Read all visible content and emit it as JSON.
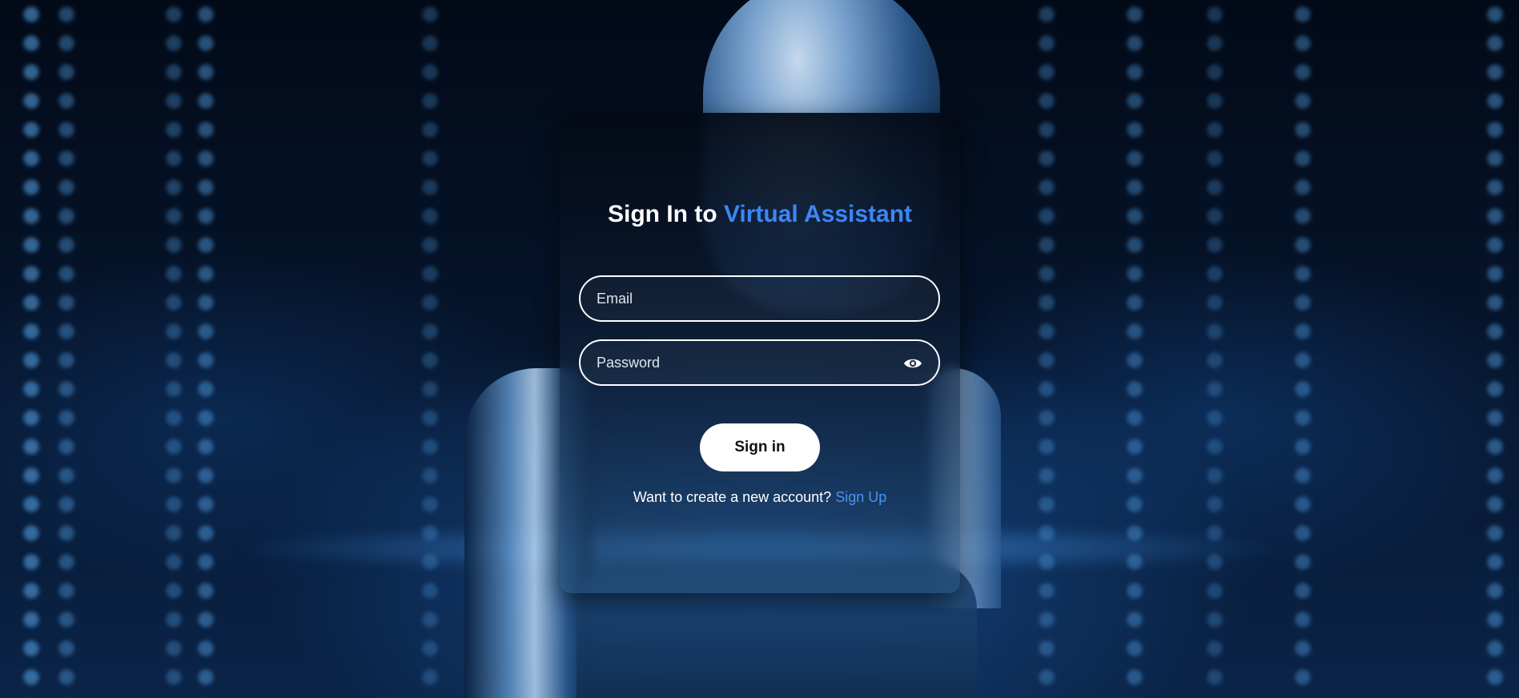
{
  "title": {
    "prefix": "Sign In to",
    "accent": "Virtual Assistant"
  },
  "form": {
    "email_placeholder": "Email",
    "email_value": "",
    "password_placeholder": "Password",
    "password_value": "",
    "password_toggle_icon": "eye-icon",
    "signin_label": "Sign in"
  },
  "footer": {
    "prompt": "Want to create a new account?",
    "signup_label": "Sign Up"
  },
  "colors": {
    "accent": "#3d86f5",
    "link": "#4a94f5",
    "button_bg": "#ffffff"
  }
}
